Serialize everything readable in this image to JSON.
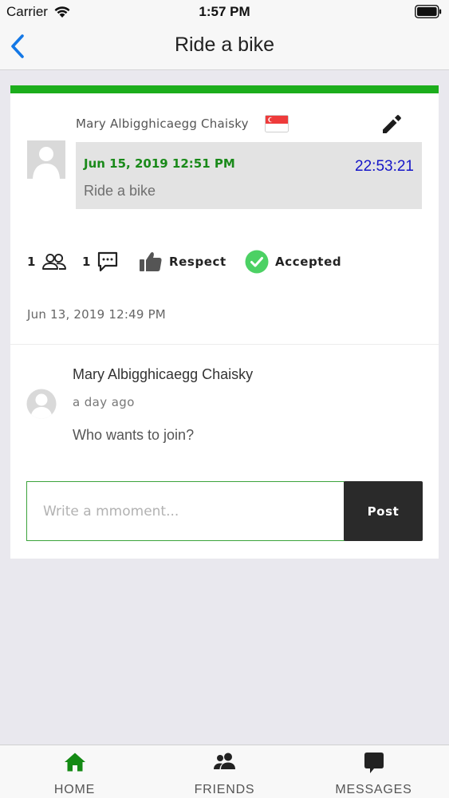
{
  "status_bar": {
    "carrier": "Carrier",
    "time": "1:57 PM",
    "icons": [
      "wifi-icon",
      "battery-icon"
    ]
  },
  "nav": {
    "title": "Ride a bike",
    "back_icon": "chevron-left-icon",
    "accent_color": "#1478e6"
  },
  "task": {
    "author": "Mary Albigghicaegg Chaisky",
    "flag_icon": "singapore-flag-icon",
    "due_date": "Jun 15, 2019 12:51 PM",
    "countdown": "22:53:21",
    "title": "Ride a bike",
    "status_color": "#1cad1c",
    "stats": {
      "participants": "1",
      "comments": "1",
      "respect_label": "Respect",
      "accepted_label": "Accepted"
    },
    "created": "Jun 13, 2019 12:49 PM"
  },
  "comments": [
    {
      "author": "Mary Albigghicaegg Chaisky",
      "time": "a day ago",
      "text": "Who wants to join?"
    }
  ],
  "composer": {
    "placeholder": "Write a mmoment...",
    "post_label": "Post"
  },
  "tabs": [
    {
      "label": "HOME",
      "icon": "home-icon",
      "active": true
    },
    {
      "label": "FRIENDS",
      "icon": "friends-icon",
      "active": false
    },
    {
      "label": "MESSAGES",
      "icon": "messages-icon",
      "active": false
    }
  ]
}
